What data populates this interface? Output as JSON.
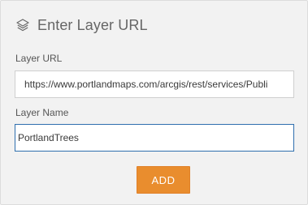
{
  "header": {
    "icon": "layers-icon",
    "title": "Enter Layer URL"
  },
  "form": {
    "url_label": "Layer URL",
    "url_value": "https://www.portlandmaps.com/arcgis/rest/services/Publi",
    "name_label": "Layer Name",
    "name_value": "PortlandTrees"
  },
  "actions": {
    "add_label": "ADD"
  },
  "colors": {
    "accent_button": "#e98d2e",
    "focus_border": "#2f6fae",
    "panel_background": "#f2f2f2"
  }
}
